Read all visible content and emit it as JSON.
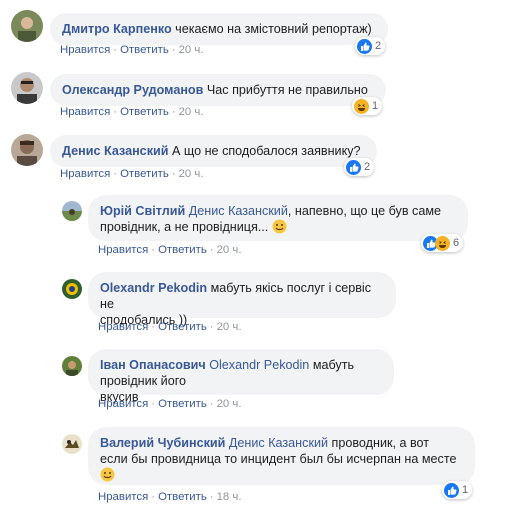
{
  "action_labels": {
    "like": "Нравится",
    "reply": "Ответить",
    "dot": "·"
  },
  "colors": {
    "link": "#385898",
    "bubble": "#f2f3f5",
    "like": "#1877f2",
    "haha": "#f7b125",
    "muted": "#90949c"
  },
  "comments": [
    {
      "author": "Дмитро Карпенко",
      "text": "чекаємо на змістовний репортаж)",
      "time": "20 ч.",
      "reaction": "like-icon",
      "reaction_count": "2"
    },
    {
      "author": "Олександр Рудоманов",
      "text": "Час прибуття не правильно",
      "time": "20 ч.",
      "reaction": "haha-icon",
      "reaction_count": "1"
    },
    {
      "author": "Денис Казанский",
      "text": "А що не сподобалося заявнику?",
      "time": "20 ч.",
      "reaction": "like-icon",
      "reaction_count": "2"
    }
  ],
  "replies": [
    {
      "author": "Юрій Світлий",
      "mention": "Денис Казанский",
      "text_line1": ", напевно, що це був саме",
      "text_line2": "провідник, а не провідниця...",
      "emoji": "smile-emoji",
      "time": "20 ч.",
      "reaction": "like-haha-icons",
      "reaction_count": "6"
    },
    {
      "author": "Olexandr Pekodin",
      "text_line1": "мабуть якісь послуг і сервіс не",
      "text_line2": "сподобались ))",
      "time": "20 ч."
    },
    {
      "author": "Іван Опанасович",
      "mention": "Olexandr Pekodin",
      "text_line1": "мабуть провідник його",
      "text_line2": "вкусив",
      "time": "20 ч."
    },
    {
      "author": "Валерий Чубинский",
      "mention": "Денис Казанский",
      "text_line1": "проводник, а вот",
      "text_line2": "если бы провидница то инцидент был бы исчерпан на месте",
      "emoji": "smile-emoji",
      "time": "18 ч.",
      "reaction": "like-icon",
      "reaction_count": "1"
    }
  ]
}
